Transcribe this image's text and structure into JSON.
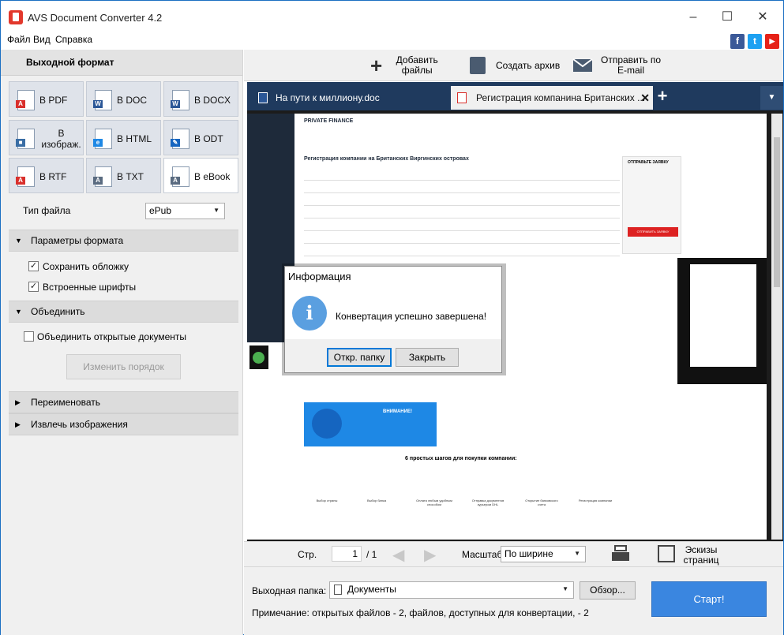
{
  "window": {
    "title": "AVS Document Converter 4.2"
  },
  "menu": [
    "Файл",
    "Вид",
    "Справка"
  ],
  "left": {
    "header": "Выходной формат",
    "formats": [
      "В PDF",
      "В DOC",
      "В DOCX",
      "В изображ.",
      "В HTML",
      "В ODT",
      "В RTF",
      "В TXT",
      "В eBook"
    ],
    "active_format": "В eBook",
    "file_type_label": "Тип файла",
    "file_type_value": "ePub",
    "section_params": "Параметры формата",
    "opt_keep_cover": "Сохранить обложку",
    "opt_embed_fonts": "Встроенные шрифты",
    "section_merge": "Объединить",
    "opt_merge_open": "Объединить открытые документы",
    "btn_change_order": "Изменить порядок",
    "section_rename": "Переименовать",
    "section_extract": "Извлечь изображения"
  },
  "toolbar": {
    "add_files": "Добавить файлы",
    "create_archive": "Создать архив",
    "send_email": "Отправить по E-mail"
  },
  "tabs": [
    "На пути к миллиону.doc",
    "Регистрация компанина Британских ..."
  ],
  "preview": {
    "heading": "Регистрация компании на Британских Виргинских островах",
    "brand": "PRIVATE FINANCE",
    "form_title": "ОТПРАВЬТЕ ЗАЯВКУ",
    "form_button": "ОТПРАВИТЬ ЗАЯВКУ",
    "attention": "ВНИМАНИЕ!",
    "steps_title": "6 простых шагов для покупки компании:",
    "steps": [
      "Выбор страны",
      "Выбор банка",
      "Оплата любым удобным способом",
      "Отправка документов курьером DHL",
      "Открытие банковского счета",
      "Регистрация компании"
    ]
  },
  "nav": {
    "page_label": "Стр.",
    "page_value": "1",
    "page_total": "/ 1",
    "zoom_label": "Масштаб",
    "zoom_value": "По ширине",
    "thumbnails": "Эскизы страниц"
  },
  "bottom": {
    "output_label": "Выходная папка:",
    "output_value": "Документы",
    "browse": "Обзор...",
    "start": "Старт!",
    "note": "Примечание: открытых файлов - 2, файлов, доступных для конвертации, - 2"
  },
  "dialog": {
    "title": "Информация",
    "message": "Конвертация успешно завершена!",
    "btn_open_folder": "Откр. папку",
    "btn_close": "Закрыть"
  },
  "colors": {
    "accent": "#3a8ee6",
    "start": "#3a86e0",
    "tabbar": "#1f3a5e",
    "dialog_focus": "#0078d7"
  }
}
